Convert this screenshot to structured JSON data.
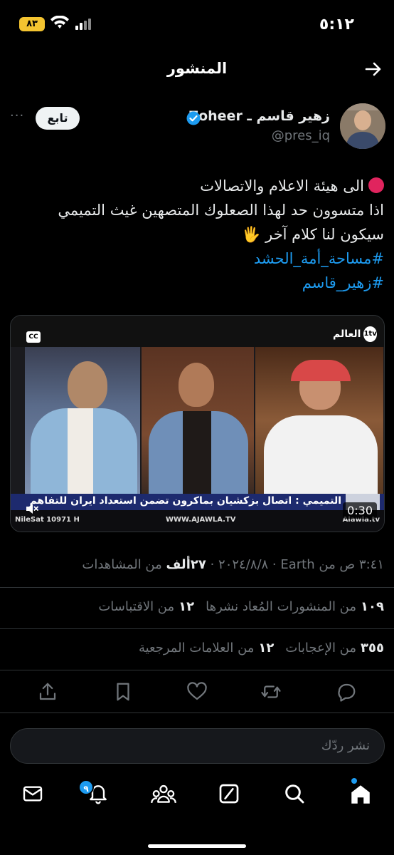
{
  "status_bar": {
    "time": "٥:١٢",
    "battery": "٨٣"
  },
  "header": {
    "title": "المنشور"
  },
  "post": {
    "display_name": "زهير قاسم ـ Zoheer",
    "handle": "@pres_iq",
    "follow_label": "تابع",
    "more": "···",
    "lines": [
      "الى هيئة الاعلام والاتصالات",
      "اذا متسوون حد لهذا الصعلوك المتصهين غيث التميمي",
      "سيكون لنا كلام آخر 🖐"
    ],
    "hashtags": [
      "#مساحة_أمة_الحشد",
      "#زهير_قاسم"
    ]
  },
  "video": {
    "cc": "CC",
    "channel": "العالم",
    "ticker": "التميمي : اتصال بزكشيان بماكرون تضمن استعداد ايران للتفاهم",
    "nilesat": "NileSat 10971 H",
    "site": "WWW.AJAWLA.TV",
    "social": "Alawla.tv",
    "duration": "0:30"
  },
  "meta": {
    "date_time": "٣:٤١ ص من Earth · ٢٠٢٤/٨/٨ ·",
    "views_count": "٢٧ألف",
    "views_label": "من المشاهدات"
  },
  "stats": {
    "reposts_count": "١٠٩",
    "reposts_label": "من المنشورات المُعاد نشرها",
    "quotes_count": "١٢",
    "quotes_label": "من الاقتباسات",
    "likes_count": "٣٥٥",
    "likes_label": "من الإعجابات",
    "bookmarks_count": "١٢",
    "bookmarks_label": "من العلامات المرجعية"
  },
  "reply": {
    "placeholder": "نشر ردّك"
  },
  "tabbar": {
    "notifications_badge": "٩"
  },
  "colors": {
    "accent": "#1d9bf0",
    "background": "#000000",
    "muted": "#71767b"
  },
  "icons": [
    "back-arrow-icon",
    "verified-icon",
    "reply-icon",
    "repost-icon",
    "like-icon",
    "bookmark-icon",
    "share-icon",
    "home-icon",
    "search-icon",
    "grok-icon",
    "communities-icon",
    "notifications-icon",
    "messages-icon",
    "mute-icon",
    "wifi-icon",
    "signal-icon"
  ]
}
